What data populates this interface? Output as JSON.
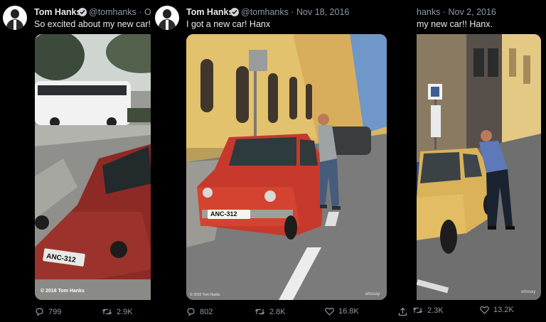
{
  "tweets": [
    {
      "name": "Tom Hanks",
      "handle": "@tomhanks",
      "meta": "@tomhanks · Oct",
      "text": "So excited about my new car! Ha",
      "photo_credit": "© 2016 Tom Hanks",
      "replies": "799",
      "retweets": "2.9K"
    },
    {
      "name": "Tom Hanks",
      "meta": "@tomhanks · Nov 18, 2016",
      "text": "I got a new car! Hanx",
      "plate": "ANC-312",
      "photo_credit": "© 2016 Tom Hanks",
      "watermark": "whosay",
      "replies": "802",
      "retweets": "2.8K",
      "likes": "16.8K"
    },
    {
      "meta": "hanks · Nov 2, 2016",
      "text": "my new car!! Hanx.",
      "watermark": "whosay",
      "retweets": "2.3K",
      "likes": "13.2K"
    }
  ],
  "plate_first": "ANC-312",
  "icons": [
    "verified-badge-icon",
    "reply-icon",
    "retweet-icon",
    "like-icon",
    "share-icon"
  ],
  "colors": {
    "background": "#000000",
    "secondary_text": "#8b98a5",
    "primary_text": "#e7e9ea",
    "car_red": "#c83a2c",
    "car_yellow": "#d9b25a"
  }
}
